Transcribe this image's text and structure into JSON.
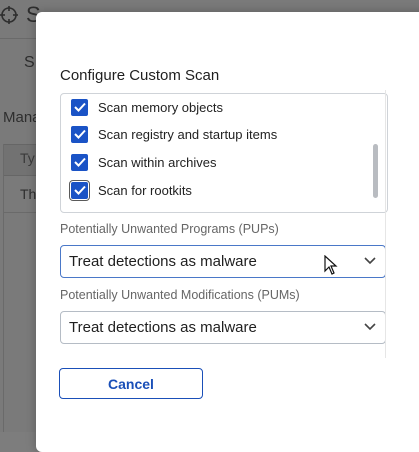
{
  "background": {
    "app_title": "S",
    "tab_label": "S",
    "section_label": "Mana",
    "table_column": "Ty",
    "table_row": "Th"
  },
  "dialog": {
    "title": "Configure Custom Scan",
    "options": [
      {
        "label": "Scan memory objects",
        "checked": true
      },
      {
        "label": "Scan registry and startup items",
        "checked": true
      },
      {
        "label": "Scan within archives",
        "checked": true
      },
      {
        "label": "Scan for rootkits",
        "checked": true
      }
    ],
    "pups": {
      "label": "Potentially Unwanted Programs (PUPs)",
      "value": "Treat detections as malware"
    },
    "pums": {
      "label": "Potentially Unwanted Modifications (PUMs)",
      "value": "Treat detections as malware"
    },
    "cancel_label": "Cancel"
  },
  "colors": {
    "accent": "#1a53c6",
    "overlay": "#7a7a7a",
    "dialog_bg": "#ffffff"
  }
}
